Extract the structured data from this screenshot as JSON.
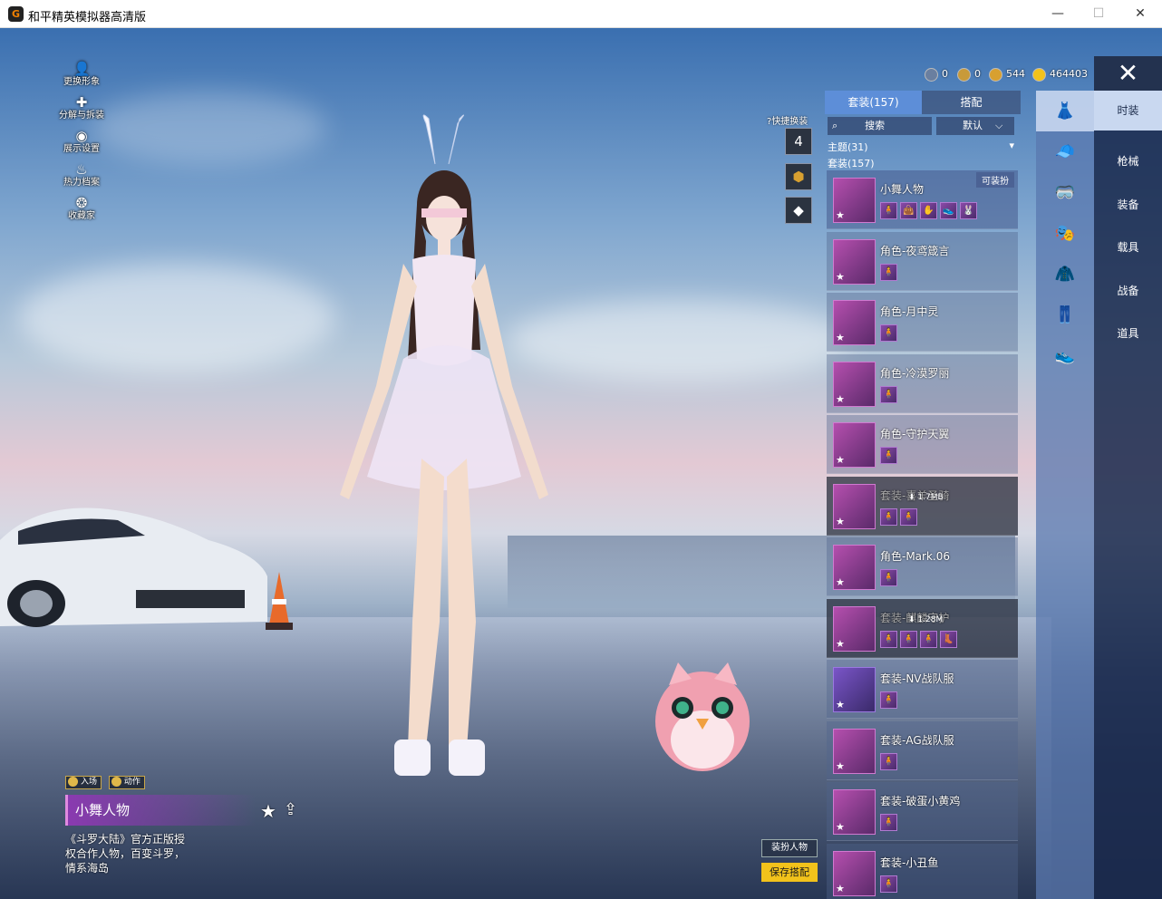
{
  "window": {
    "title": "和平精英模拟器高清版",
    "icon_letter": "G",
    "minimize": "—",
    "maximize": "☐",
    "close": "✕"
  },
  "left_menu": [
    {
      "label": "更换形象",
      "icon": "person-icon"
    },
    {
      "label": "分解与拆装",
      "icon": "puzzle-icon"
    },
    {
      "label": "展示设置",
      "icon": "eye-icon"
    },
    {
      "label": "热力档案",
      "icon": "flame-icon"
    },
    {
      "label": "收藏家",
      "icon": "collector-badge-icon"
    }
  ],
  "currency": [
    {
      "value": "0",
      "color": "#6a7fa0"
    },
    {
      "value": "0",
      "color": "#c89a3a"
    },
    {
      "value": "544",
      "color": "#d8a030"
    },
    {
      "value": "464403",
      "color": "#f2c21b"
    }
  ],
  "close_label": "✕",
  "quick_change": {
    "label": "快捷换装",
    "help": "?",
    "slot_number": "4"
  },
  "tabs": [
    {
      "label": "套装(157)",
      "active": true
    },
    {
      "label": "搭配",
      "active": false
    }
  ],
  "search": {
    "label": "搜索",
    "sort": "默认"
  },
  "theme_label": "主题(31)",
  "suit_label": "套装(157)",
  "items": [
    {
      "name": "小舞人物",
      "badge": "可装扮",
      "minis": [
        "🧍",
        "👜",
        "✋",
        "👟",
        "🐰"
      ],
      "state": "selected"
    },
    {
      "name": "角色-夜鸢箴言",
      "minis": [
        "🧍"
      ],
      "state": "normal"
    },
    {
      "name": "角色-月中灵",
      "minis": [
        "🧍"
      ],
      "state": "normal"
    },
    {
      "name": "角色-冷漠罗丽",
      "minis": [
        "🧍"
      ],
      "state": "normal"
    },
    {
      "name": "角色-守护天翼",
      "minis": [
        "🧍"
      ],
      "state": "normal"
    },
    {
      "name": "套装-喜羊圣骑",
      "minis": [
        "🧍",
        "🧍"
      ],
      "size": "1.7MB",
      "state": "dim"
    },
    {
      "name": "角色-Mark.06",
      "minis": [
        "🧍"
      ],
      "state": "normal"
    },
    {
      "name": "套装-麒麟守护",
      "minis": [
        "🧍",
        "🧍",
        "🧍",
        "👢"
      ],
      "size": "1.28M",
      "state": "dim"
    },
    {
      "name": "套装-NV战队服",
      "minis": [
        "🧍"
      ],
      "state": "purple"
    },
    {
      "name": "套装-AG战队服",
      "minis": [
        "🧍"
      ],
      "state": "normal"
    },
    {
      "name": "套装-破蛋小黄鸡",
      "minis": [
        "🧍"
      ],
      "state": "normal"
    },
    {
      "name": "套装-小丑鱼",
      "minis": [
        "🧍"
      ],
      "state": "normal"
    }
  ],
  "categories": [
    {
      "icon": "outfit-icon",
      "glyph": "👗",
      "active": true
    },
    {
      "icon": "cap-icon",
      "glyph": "🧢",
      "active": false
    },
    {
      "icon": "goggles-icon",
      "glyph": "🥽",
      "active": false
    },
    {
      "icon": "mask-icon",
      "glyph": "🎭",
      "active": false
    },
    {
      "icon": "jacket-icon",
      "glyph": "🧥",
      "active": false
    },
    {
      "icon": "pants-icon",
      "glyph": "👖",
      "active": false
    },
    {
      "icon": "shoes-icon",
      "glyph": "👟",
      "active": false
    }
  ],
  "right_tabs": [
    {
      "label": "时装",
      "active": true
    },
    {
      "label": "枪械",
      "active": false
    },
    {
      "label": "装备",
      "active": false
    },
    {
      "label": "载具",
      "active": false
    },
    {
      "label": "战备",
      "active": false
    },
    {
      "label": "道具",
      "active": false
    }
  ],
  "actions": {
    "enter": "入场",
    "move": "动作"
  },
  "outfit": {
    "name": "小舞人物",
    "description": "《斗罗大陆》官方正版授权合作人物，百变斗罗，情系海岛"
  },
  "dress_btn": "装扮人物",
  "save_btn": "保存搭配"
}
